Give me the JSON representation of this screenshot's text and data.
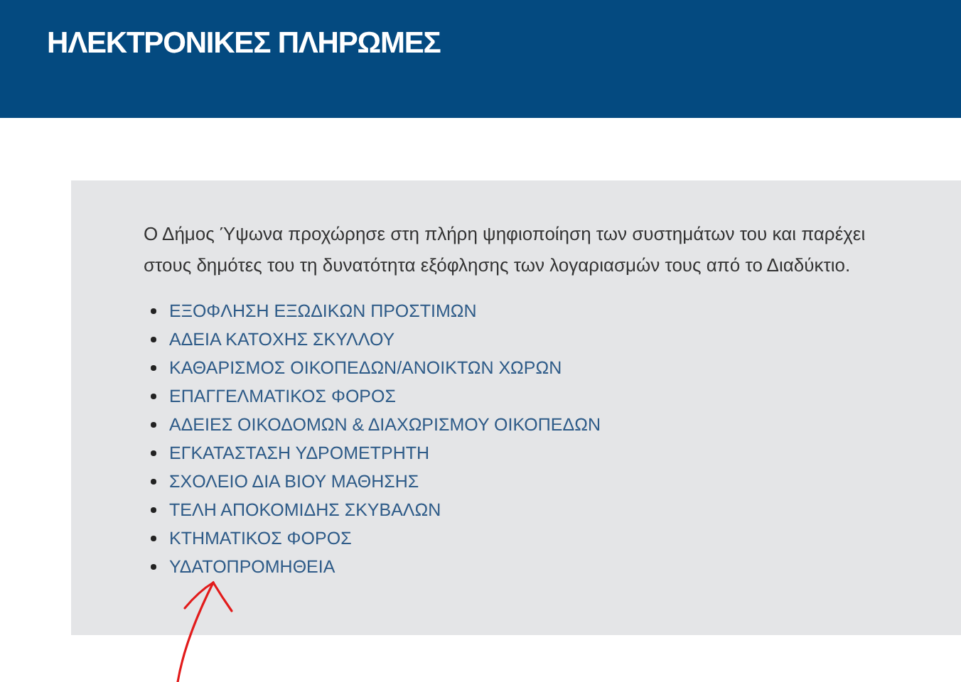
{
  "header": {
    "title": "ΗΛΕΚΤΡΟΝΙΚΕΣ ΠΛΗΡΩΜΕΣ"
  },
  "panel": {
    "intro": "Ο Δήμος Ύψωνα προχώρησε στη πλήρη ψηφιοποίηση των συστημάτων του και παρέχει στους δημότες του τη δυνατότητα εξόφλησης των λογαριασμών τους από το Διαδύκτιο.",
    "links": [
      {
        "label": "ΕΞΟΦΛΗΣΗ ΕΞΩΔΙΚΩΝ ΠΡΟΣΤΙΜΩΝ"
      },
      {
        "label": "ΑΔΕΙΑ ΚΑΤΟΧΗΣ ΣΚΥΛΛΟΥ"
      },
      {
        "label": "ΚΑΘΑΡΙΣΜΟΣ ΟΙΚΟΠΕΔΩΝ/ΑΝΟΙΚΤΩΝ ΧΩΡΩΝ"
      },
      {
        "label": "ΕΠΑΓΓΕΛΜΑΤΙΚΟΣ ΦΟΡΟΣ"
      },
      {
        "label": "ΑΔΕΙΕΣ ΟΙΚΟΔΟΜΩΝ & ΔΙΑΧΩΡΙΣΜΟΥ ΟΙΚΟΠΕΔΩΝ"
      },
      {
        "label": "ΕΓΚΑΤΑΣΤΑΣΗ ΥΔΡΟΜΕΤΡΗΤΗ"
      },
      {
        "label": "ΣΧΟΛΕΙΟ ΔΙΑ ΒΙΟΥ ΜΑΘΗΣΗΣ"
      },
      {
        "label": "ΤΕΛΗ ΑΠΟΚΟΜΙΔΗΣ ΣΚΥΒΑΛΩΝ"
      },
      {
        "label": "ΚΤΗΜΑΤΙΚΟΣ ΦΟΡΟΣ"
      },
      {
        "label": "ΥΔΑΤΟΠΡΟΜΗΘΕΙΑ"
      }
    ]
  }
}
